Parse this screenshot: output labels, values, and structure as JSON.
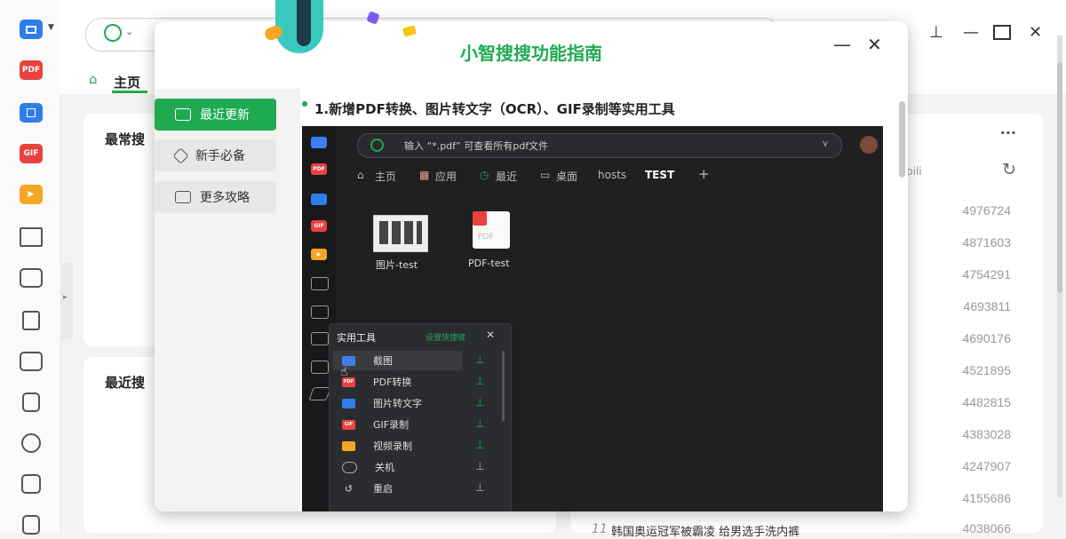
{
  "main": {
    "tabs": {
      "home": "主页"
    },
    "sections": {
      "frequent": "最常搜",
      "recent": "最近搜"
    },
    "right_panel": {
      "more": "···",
      "partial_text": "bili",
      "counts": [
        "4976724",
        "4871603",
        "4754291",
        "4693811",
        "4690176",
        "4521895",
        "4482815",
        "4383028",
        "4247907",
        "4155686",
        "4038066"
      ],
      "bottom_item_number": "11",
      "bottom_item_text": "韩国奥运冠军被霸凌 给男选手洗内裤"
    }
  },
  "left_toolbar": {
    "items": [
      {
        "icon": "screenshot-icon",
        "text": ""
      },
      {
        "icon": "pdf-icon",
        "text": "PDF"
      },
      {
        "icon": "ocr-icon",
        "text": ""
      },
      {
        "icon": "gif-icon",
        "text": "GIF"
      },
      {
        "icon": "video-record-icon",
        "text": ""
      },
      {
        "icon": "desktop-icon",
        "text": ""
      },
      {
        "icon": "calculator-icon",
        "text": ""
      },
      {
        "icon": "lock-icon",
        "text": ""
      },
      {
        "icon": "monitor-icon",
        "text": ""
      },
      {
        "icon": "notes-icon",
        "text": ""
      },
      {
        "icon": "power-icon",
        "text": ""
      },
      {
        "icon": "cleanup-icon",
        "text": ""
      },
      {
        "icon": "trash-icon",
        "text": ""
      }
    ]
  },
  "dialog": {
    "title": "小智搜搜功能指南",
    "nav": [
      "最近更新",
      "新手必备",
      "更多攻略"
    ],
    "headline": "1.新增PDF转换、图片转文字（OCR）、GIF录制等实用工具",
    "preview": {
      "search_placeholder": "输入 “*.pdf” 可查看所有pdf文件",
      "tabs": [
        "主页",
        "应用",
        "最近",
        "桌面",
        "hosts",
        "TEST",
        "+"
      ],
      "files": [
        {
          "name": "图片-test",
          "icon": "image-file-icon"
        },
        {
          "name": "PDF-test",
          "icon": "pdf-file-icon"
        }
      ],
      "tools_menu": {
        "title": "实用工具",
        "shortcut_link": "设置快捷键",
        "close": "✕",
        "items": [
          {
            "label": "截图",
            "badge": "",
            "color": "#3d7ff0"
          },
          {
            "label": "PDF转换",
            "badge": "PDF",
            "color": "#e8423f"
          },
          {
            "label": "图片转文字",
            "badge": "",
            "color": "#2f7de8"
          },
          {
            "label": "GIF录制",
            "badge": "GIF",
            "color": "#e8423f"
          },
          {
            "label": "视频录制",
            "badge": "",
            "color": "#f5a623"
          },
          {
            "label": "关机",
            "badge": "",
            "color": ""
          },
          {
            "label": "重启",
            "badge": "",
            "color": ""
          }
        ]
      }
    }
  },
  "colors": {
    "accent": "#1faa52",
    "pdf_red": "#e8423f",
    "ocr_blue": "#2f7de8",
    "video_orange": "#f5a623"
  }
}
